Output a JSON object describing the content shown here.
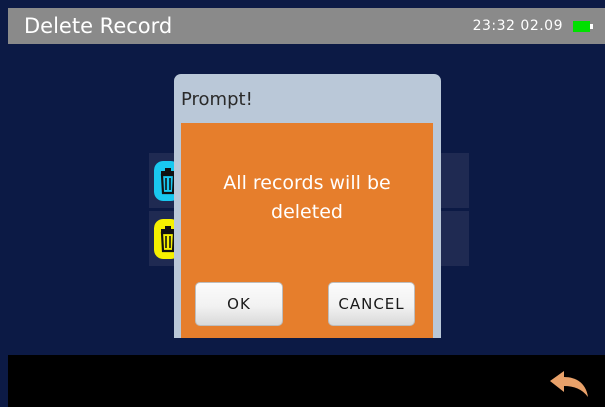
{
  "window": {
    "title": "Delete Record",
    "time": "23:32",
    "date": "02.09",
    "battery_icon": "battery-icon",
    "battery_color": "#00e000"
  },
  "records": [
    {
      "icon": "trash-icon",
      "color": "#19c8f0"
    },
    {
      "icon": "trash-icon",
      "color": "#f5f000"
    }
  ],
  "dialog": {
    "title": "Prompt!",
    "message": "All records will be deleted",
    "ok_label": "OK",
    "cancel_label": "CANCEL",
    "body_color": "#e67e2c"
  },
  "bottom_bar": {
    "back_icon": "back-arrow-icon",
    "back_color": "#e8a16a"
  }
}
